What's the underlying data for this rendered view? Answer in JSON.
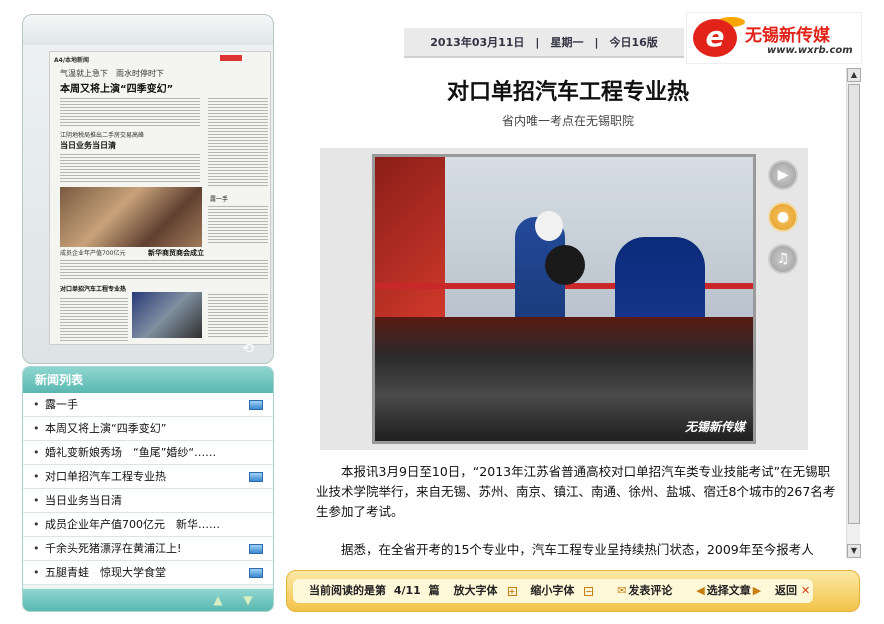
{
  "thumbnail": {
    "header": "A4/本地新闻",
    "headline1": "气温就上急下　雨水时停时下",
    "headline2": "本周又将上演“四季变幻”",
    "headline3": "江阴地税局推出二手房交易高峰",
    "headline4": "当日业务当日清",
    "headline5": "成员企业年产值700亿元",
    "headline6": "新华商贸商会成立",
    "headline7": "对口单招汽车工程专业热",
    "headline8": "露一手"
  },
  "news_list": {
    "title": "新闻列表",
    "items": [
      {
        "label": "露一手",
        "video": true
      },
      {
        "label": "本周又将上演“四季变幻”",
        "video": false
      },
      {
        "label": "婚礼变新娘秀场　“鱼尾”婚纱“……",
        "video": false
      },
      {
        "label": "对口单招汽车工程专业热",
        "video": true
      },
      {
        "label": "当日业务当日清",
        "video": false
      },
      {
        "label": "成员企业年产值700亿元　新华……",
        "video": false
      },
      {
        "label": "千余头死猪漂浮在黄浦江上!",
        "video": true
      },
      {
        "label": "五腿青蛙　惊现大学食堂",
        "video": true
      }
    ]
  },
  "header": {
    "date_info": "2013年03月11日　|　星期一　|　今日16版",
    "logo_name": "无锡新传媒",
    "logo_url": "www.wxrb.com"
  },
  "article": {
    "title": "对口单招汽车工程专业热",
    "subtitle": "省内唯一考点在无锡职院",
    "photo_watermark": "无锡新传媒",
    "paragraph1": "本报讯3月9日至10日，“2013年江苏省普通高校对口单招汽车类专业技能考试”在无锡职业技术学院举行，来自无锡、苏州、南京、镇江、南通、徐州、盐城、宿迁8个城市的267名考生参加了考试。",
    "paragraph2": "据悉，在全省开考的15个专业中，汽车工程专业呈持续热门状态，2009年至今报考人"
  },
  "side_icons": [
    "video-icon",
    "person-icon",
    "headphones-icon"
  ],
  "bottom_bar": {
    "reading_label": "当前阅读的是第",
    "reading_value": "4/11",
    "reading_unit": "篇",
    "enlarge": "放大字体",
    "shrink": "缩小字体",
    "comment": "发表评论",
    "select": "选择文章",
    "back": "返回"
  },
  "colors": {
    "accent_teal": "#5ab8b1",
    "accent_orange": "#f2c34a",
    "brand_red": "#e2231a"
  }
}
